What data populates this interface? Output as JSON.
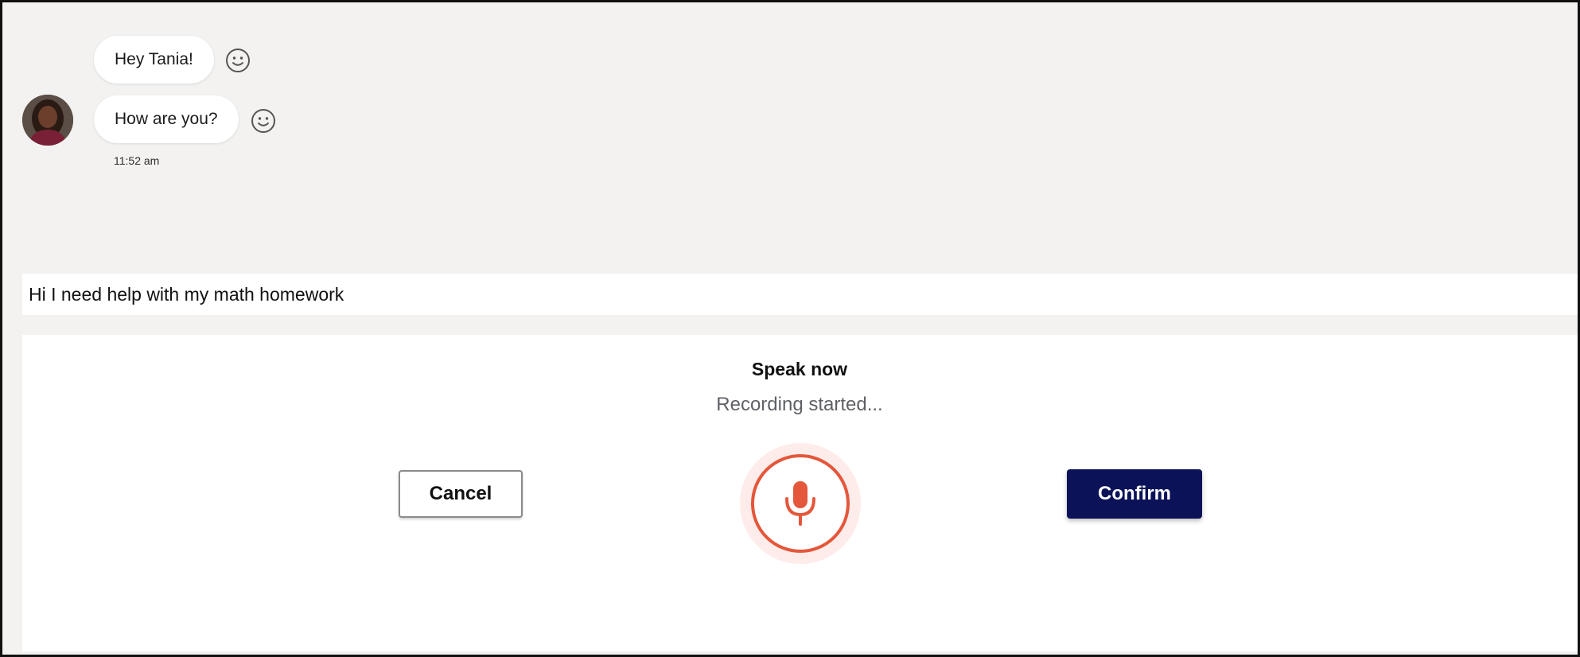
{
  "chat": {
    "messages": [
      {
        "text": "Hey Tania!",
        "reaction_icon": "smiley-icon"
      },
      {
        "text": "How are you?",
        "reaction_icon": "smiley-icon"
      }
    ],
    "timestamp": "11:52 am",
    "avatar_icon": "user-avatar"
  },
  "composer": {
    "value": "Hi I need help with my math homework"
  },
  "voice": {
    "title": "Speak now",
    "status": "Recording started...",
    "cancel_label": "Cancel",
    "confirm_label": "Confirm",
    "mic_icon": "microphone-icon",
    "state": "recording"
  },
  "colors": {
    "background": "#f3f2f1",
    "panel": "#ffffff",
    "mic_accent": "#e4573b",
    "mic_halo": "#fdecea",
    "confirm": "#0b1258",
    "status_text": "#5f6166"
  }
}
